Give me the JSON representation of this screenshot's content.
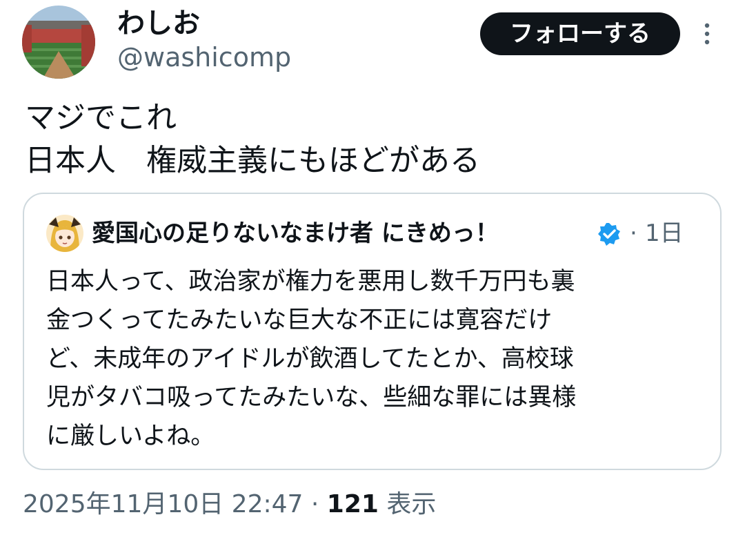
{
  "author": {
    "display_name": "わしお",
    "handle": "@washicomp",
    "avatar_icon": "stadium-photo-avatar"
  },
  "follow_button": {
    "label": "フォローする",
    "background": "#0f1419",
    "text_color": "#ffffff"
  },
  "more_icon": "vertical-ellipsis-icon",
  "tweet": {
    "lines": [
      "マジでこれ",
      "日本人　権威主義にもほどがある"
    ]
  },
  "quote": {
    "display_name": "愛国心の足りないなまけ者 にきめっ！",
    "verified_icon": "verified-badge-icon",
    "verified_color": "#1d9bf0",
    "separator": "·",
    "time": "1日",
    "body_lines": [
      "日本人って、政治家が権力を悪用し数千万円も裏",
      "金つくってたみたいな巨大な不正には寛容だけ",
      "ど、未成年のアイドルが飲酒してたとか、高校球",
      "児がタバコ吸ってたみたいな、些細な罪には異様",
      "に厳しいよね。"
    ]
  },
  "meta": {
    "timestamp": "2025年11月10日 22:47",
    "separator": "·",
    "views_count": "121",
    "views_label": "表示"
  },
  "colors": {
    "text": "#0f1419",
    "secondary": "#536471",
    "border": "#cfd9de"
  }
}
